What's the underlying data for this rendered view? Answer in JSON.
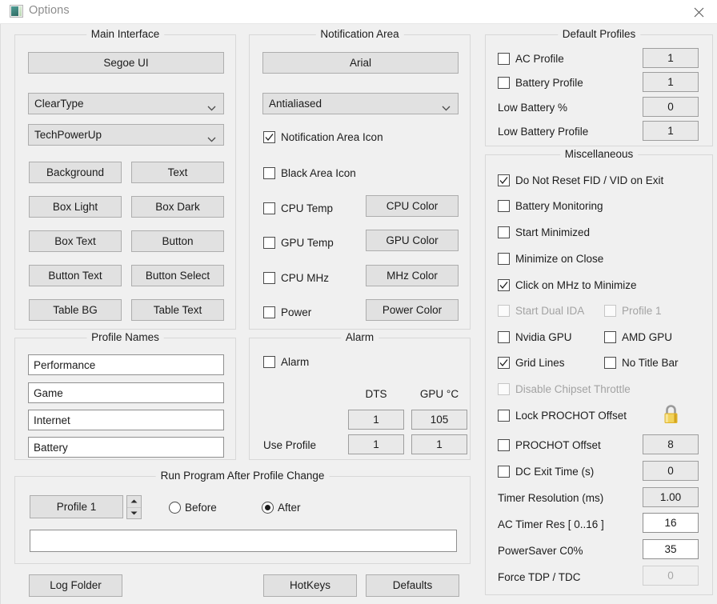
{
  "window": {
    "title": "Options",
    "icon": "app-window-icon",
    "close_icon": "close-icon"
  },
  "main_interface": {
    "legend": "Main Interface",
    "font_button": "Segoe UI",
    "rendering_combo": "ClearType",
    "theme_combo": "TechPowerUp",
    "color_buttons": [
      "Background",
      "Text",
      "Box Light",
      "Box Dark",
      "Box Text",
      "Button",
      "Button Text",
      "Button Select",
      "Table BG",
      "Table Text"
    ]
  },
  "notification_area": {
    "legend": "Notification Area",
    "font_button": "Arial",
    "smoothing_combo": "Antialiased",
    "checkboxes": [
      {
        "label": "Notification Area Icon",
        "checked": true,
        "disabled": false
      },
      {
        "label": "Black Area Icon",
        "checked": false,
        "disabled": false
      },
      {
        "label": "CPU Temp",
        "checked": false,
        "disabled": false
      },
      {
        "label": "GPU Temp",
        "checked": false,
        "disabled": false
      },
      {
        "label": "CPU MHz",
        "checked": false,
        "disabled": false
      },
      {
        "label": "Power",
        "checked": false,
        "disabled": false
      }
    ],
    "color_buttons": [
      "CPU Color",
      "GPU Color",
      "MHz Color",
      "Power Color"
    ]
  },
  "default_profiles": {
    "legend": "Default Profiles",
    "rows": [
      {
        "label": "AC Profile",
        "type": "checkbox",
        "checked": false,
        "value": "1"
      },
      {
        "label": "Battery Profile",
        "type": "checkbox",
        "checked": false,
        "value": "1"
      },
      {
        "label": "Low Battery %",
        "type": "label",
        "checked": false,
        "value": "0"
      },
      {
        "label": "Low Battery Profile",
        "type": "label",
        "checked": false,
        "value": "1"
      }
    ]
  },
  "miscellaneous": {
    "legend": "Miscellaneous",
    "checks": [
      {
        "label": "Do Not Reset FID / VID on Exit",
        "checked": true,
        "disabled": false
      },
      {
        "label": "Battery Monitoring",
        "checked": false,
        "disabled": false
      },
      {
        "label": "Start Minimized",
        "checked": false,
        "disabled": false
      },
      {
        "label": "Minimize on Close",
        "checked": false,
        "disabled": false
      },
      {
        "label": "Click on MHz to Minimize",
        "checked": true,
        "disabled": false
      },
      {
        "label": "Start Dual IDA",
        "checked": false,
        "disabled": true
      },
      {
        "label": "Profile 1",
        "checked": false,
        "disabled": true
      },
      {
        "label": "Nvidia GPU",
        "checked": false,
        "disabled": false
      },
      {
        "label": "AMD GPU",
        "checked": false,
        "disabled": false
      },
      {
        "label": "Grid Lines",
        "checked": true,
        "disabled": false
      },
      {
        "label": "No Title Bar",
        "checked": false,
        "disabled": false
      },
      {
        "label": "Disable Chipset Throttle",
        "checked": false,
        "disabled": true
      },
      {
        "label": "Lock PROCHOT Offset",
        "checked": false,
        "disabled": false
      }
    ],
    "lock_icon": "padlock-icon",
    "value_rows": [
      {
        "label": "PROCHOT Offset",
        "type": "checkbox",
        "checked": false,
        "value": "8",
        "style": "gray",
        "disabled": false
      },
      {
        "label": "DC Exit Time (s)",
        "type": "checkbox",
        "checked": false,
        "value": "0",
        "style": "gray",
        "disabled": false
      },
      {
        "label": "Timer Resolution (ms)",
        "type": "label",
        "checked": false,
        "value": "1.00",
        "style": "gray",
        "disabled": false
      },
      {
        "label": "AC Timer Res [ 0..16 ]",
        "type": "label",
        "checked": false,
        "value": "16",
        "style": "white",
        "disabled": false
      },
      {
        "label": "PowerSaver C0%",
        "type": "label",
        "checked": false,
        "value": "35",
        "style": "white",
        "disabled": false
      },
      {
        "label": "Force TDP / TDC",
        "type": "label",
        "checked": false,
        "value": "0",
        "style": "gray",
        "disabled": true
      }
    ]
  },
  "profile_names": {
    "legend": "Profile Names",
    "values": [
      "Performance",
      "Game",
      "Internet",
      "Battery"
    ]
  },
  "alarm": {
    "legend": "Alarm",
    "enable_label": "Alarm",
    "enable_checked": false,
    "col_dts": "DTS",
    "col_gpu": "GPU °C",
    "threshold_dts": "1",
    "threshold_gpu": "105",
    "use_profile_label": "Use Profile",
    "use_profile_dts": "1",
    "use_profile_gpu": "1"
  },
  "run_program": {
    "legend": "Run Program After Profile Change",
    "profile_button": "Profile 1",
    "radio_before": "Before",
    "radio_after": "After",
    "selected_radio": "After",
    "path_value": "",
    "path_placeholder": ""
  },
  "footer": {
    "log_folder": "Log Folder",
    "hotkeys": "HotKeys",
    "defaults": "Defaults"
  },
  "colors": {
    "dialog_bg": "#f0f0f0",
    "control_bg": "#e1e1e1",
    "border": "#adadad",
    "text": "#1c1c1c",
    "disabled_text": "#a3a3a3",
    "lock_gold": "#e8b923"
  }
}
